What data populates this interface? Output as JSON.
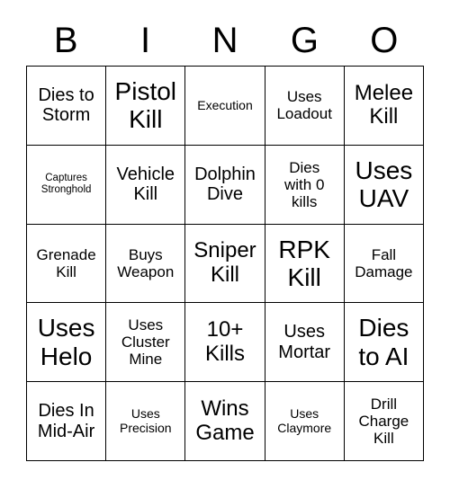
{
  "card": {
    "title_letters": [
      "B",
      "I",
      "N",
      "G",
      "O"
    ],
    "columns": 5,
    "rows": 5,
    "border_color": "#000000",
    "background_color": "#ffffff",
    "text_color": "#000000"
  },
  "cells": [
    {
      "text": "Dies to\nStorm",
      "size": "fs-lg"
    },
    {
      "text": "Pistol\nKill",
      "size": "fs-xxl"
    },
    {
      "text": "Execution",
      "size": "fs-sm"
    },
    {
      "text": "Uses\nLoadout",
      "size": "fs-md"
    },
    {
      "text": "Melee\nKill",
      "size": "fs-xl"
    },
    {
      "text": "Captures\nStronghold",
      "size": "fs-xs"
    },
    {
      "text": "Vehicle\nKill",
      "size": "fs-lg"
    },
    {
      "text": "Dolphin\nDive",
      "size": "fs-lg"
    },
    {
      "text": "Dies\nwith 0\nkills",
      "size": "fs-md"
    },
    {
      "text": "Uses\nUAV",
      "size": "fs-xxl"
    },
    {
      "text": "Grenade\nKill",
      "size": "fs-md"
    },
    {
      "text": "Buys\nWeapon",
      "size": "fs-md"
    },
    {
      "text": "Sniper\nKill",
      "size": "fs-xl"
    },
    {
      "text": "RPK\nKill",
      "size": "fs-xxl"
    },
    {
      "text": "Fall\nDamage",
      "size": "fs-md"
    },
    {
      "text": "Uses\nHelo",
      "size": "fs-xxl"
    },
    {
      "text": "Uses\nCluster\nMine",
      "size": "fs-md"
    },
    {
      "text": "10+\nKills",
      "size": "fs-xl"
    },
    {
      "text": "Uses\nMortar",
      "size": "fs-lg"
    },
    {
      "text": "Dies\nto AI",
      "size": "fs-xxl"
    },
    {
      "text": "Dies In\nMid-Air",
      "size": "fs-lg"
    },
    {
      "text": "Uses\nPrecision",
      "size": "fs-sm"
    },
    {
      "text": "Wins\nGame",
      "size": "fs-xl"
    },
    {
      "text": "Uses\nClaymore",
      "size": "fs-sm"
    },
    {
      "text": "Drill\nCharge\nKill",
      "size": "fs-md"
    }
  ]
}
